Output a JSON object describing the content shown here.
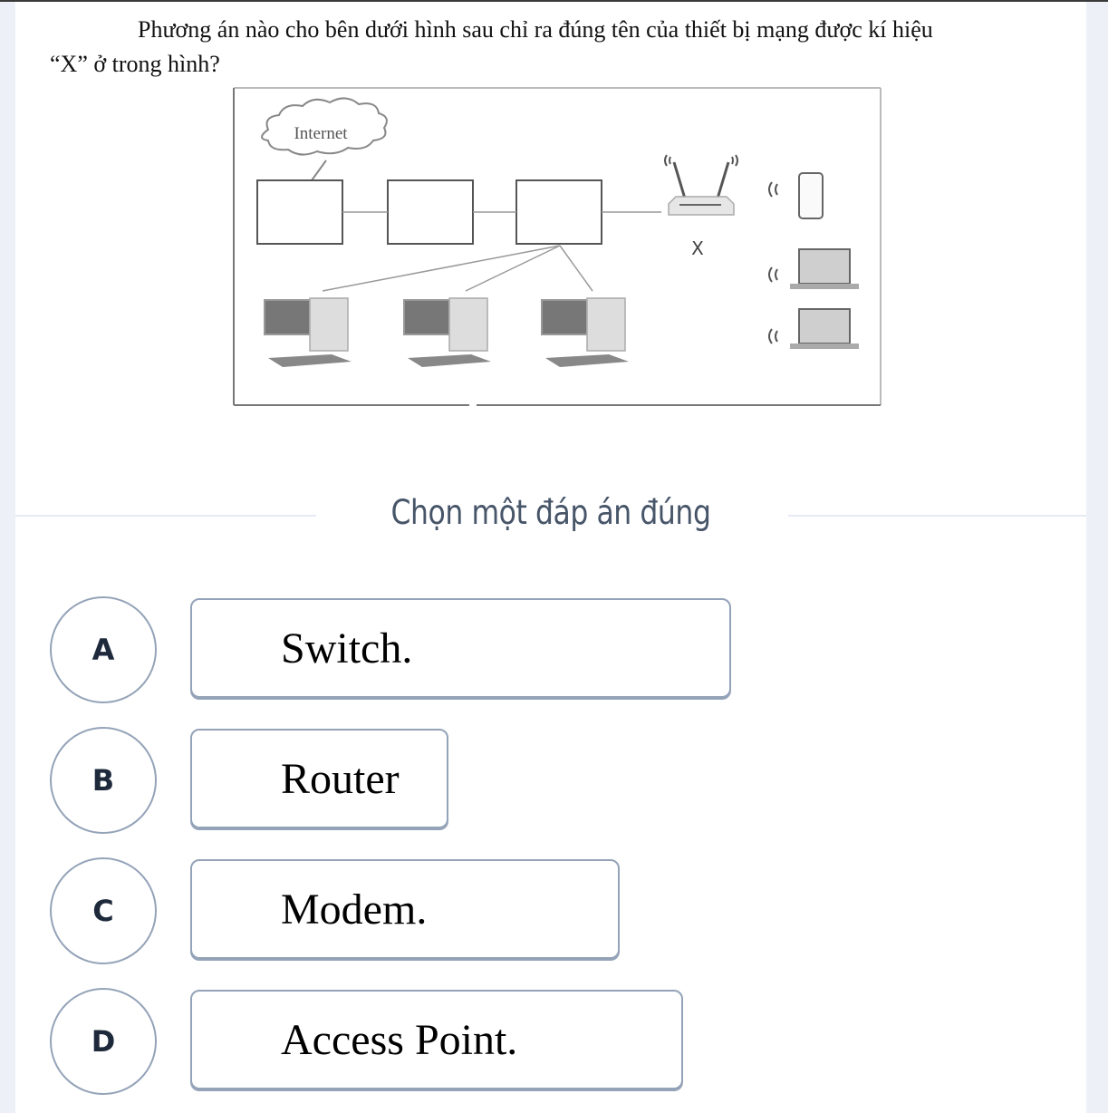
{
  "question": {
    "line1": "Phương án nào cho bên dưới hình sau chỉ ra đúng tên của thiết bị mạng được kí hiệu",
    "line2": "“X” ở trong hình?"
  },
  "figure": {
    "cloud_label": "Internet",
    "device_label": "X"
  },
  "instruction": "Chọn một đáp án đúng",
  "options": [
    {
      "letter": "A",
      "text": "Switch."
    },
    {
      "letter": "B",
      "text": "Router"
    },
    {
      "letter": "C",
      "text": "Modem."
    },
    {
      "letter": "D",
      "text": "Access Point."
    }
  ]
}
